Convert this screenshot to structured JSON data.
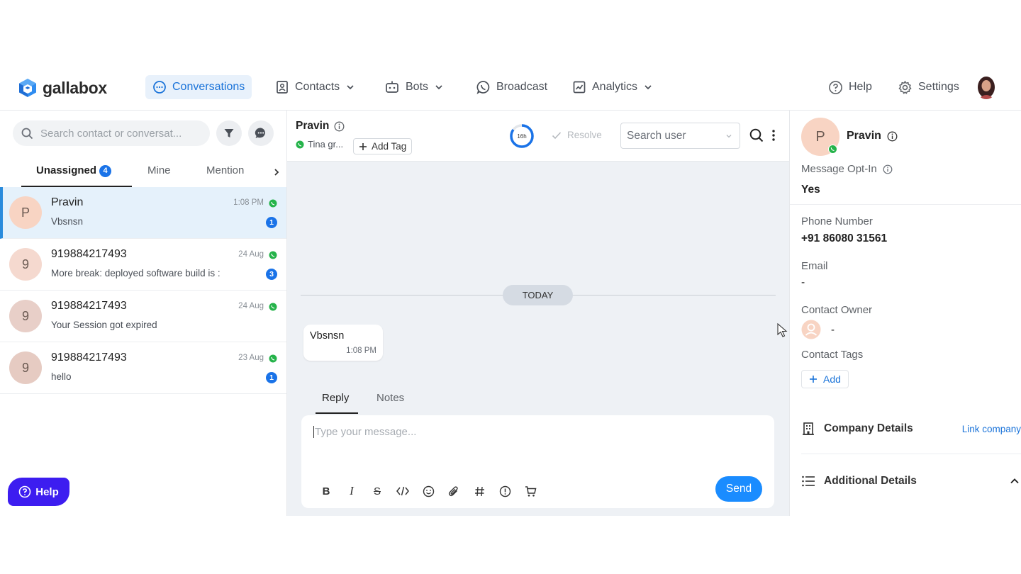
{
  "brand": {
    "name": "gallabox",
    "color": "#1a73d9"
  },
  "nav": {
    "items": [
      {
        "label": "Conversations",
        "icon": "chat-bubble-icon",
        "active": true
      },
      {
        "label": "Contacts",
        "icon": "contact-card-icon",
        "dropdown": true
      },
      {
        "label": "Bots",
        "icon": "robot-icon",
        "dropdown": true
      },
      {
        "label": "Broadcast",
        "icon": "whatsapp-icon"
      },
      {
        "label": "Analytics",
        "icon": "chart-icon",
        "dropdown": true
      }
    ],
    "help": "Help",
    "settings": "Settings"
  },
  "left": {
    "search_placeholder": "Search contact or conversat...",
    "tabs": [
      {
        "label": "Unassigned",
        "count": "4",
        "active": true
      },
      {
        "label": "Mine"
      },
      {
        "label": "Mention"
      }
    ],
    "conversations": [
      {
        "initial": "P",
        "name": "Pravin",
        "preview": "Vbsnsn",
        "time": "1:08 PM",
        "unread": "1",
        "avatar_color": "#f8d4c3",
        "selected": true
      },
      {
        "initial": "9",
        "name": "919884217493",
        "preview": "More break: deployed software build is :",
        "time": "24 Aug",
        "unread": "3",
        "avatar_color": "#f5d9cf"
      },
      {
        "initial": "9",
        "name": "919884217493",
        "preview": "Your Session got expired",
        "time": "24 Aug",
        "unread": "",
        "avatar_color": "#e8cfc8"
      },
      {
        "initial": "9",
        "name": "919884217493",
        "preview": "hello",
        "time": "23 Aug",
        "unread": "1",
        "avatar_color": "#e6cbc2"
      }
    ],
    "help_button": "Help"
  },
  "chat": {
    "contact_name": "Pravin",
    "channel_name": "Tina gr...",
    "add_tag": "Add Tag",
    "timer_label": "16h",
    "timer_fraction": 0.85,
    "resolve": "Resolve",
    "assign_placeholder": "Search user",
    "divider": "TODAY",
    "messages": [
      {
        "text": "Vbsnsn",
        "time": "1:08 PM"
      }
    ],
    "reply_tabs": [
      "Reply",
      "Notes"
    ],
    "composer_placeholder": "Type your message...",
    "send": "Send"
  },
  "contact": {
    "initial": "P",
    "name": "Pravin",
    "opt_in_label": "Message Opt-In",
    "opt_in_value": "Yes",
    "phone_label": "Phone Number",
    "phone_value": "+91 86080 31561",
    "email_label": "Email",
    "email_value": "-",
    "owner_label": "Contact Owner",
    "owner_value": "-",
    "tags_label": "Contact Tags",
    "add_tag": "Add",
    "company_label": "Company Details",
    "link_company": "Link company",
    "additional_label": "Additional Details"
  }
}
